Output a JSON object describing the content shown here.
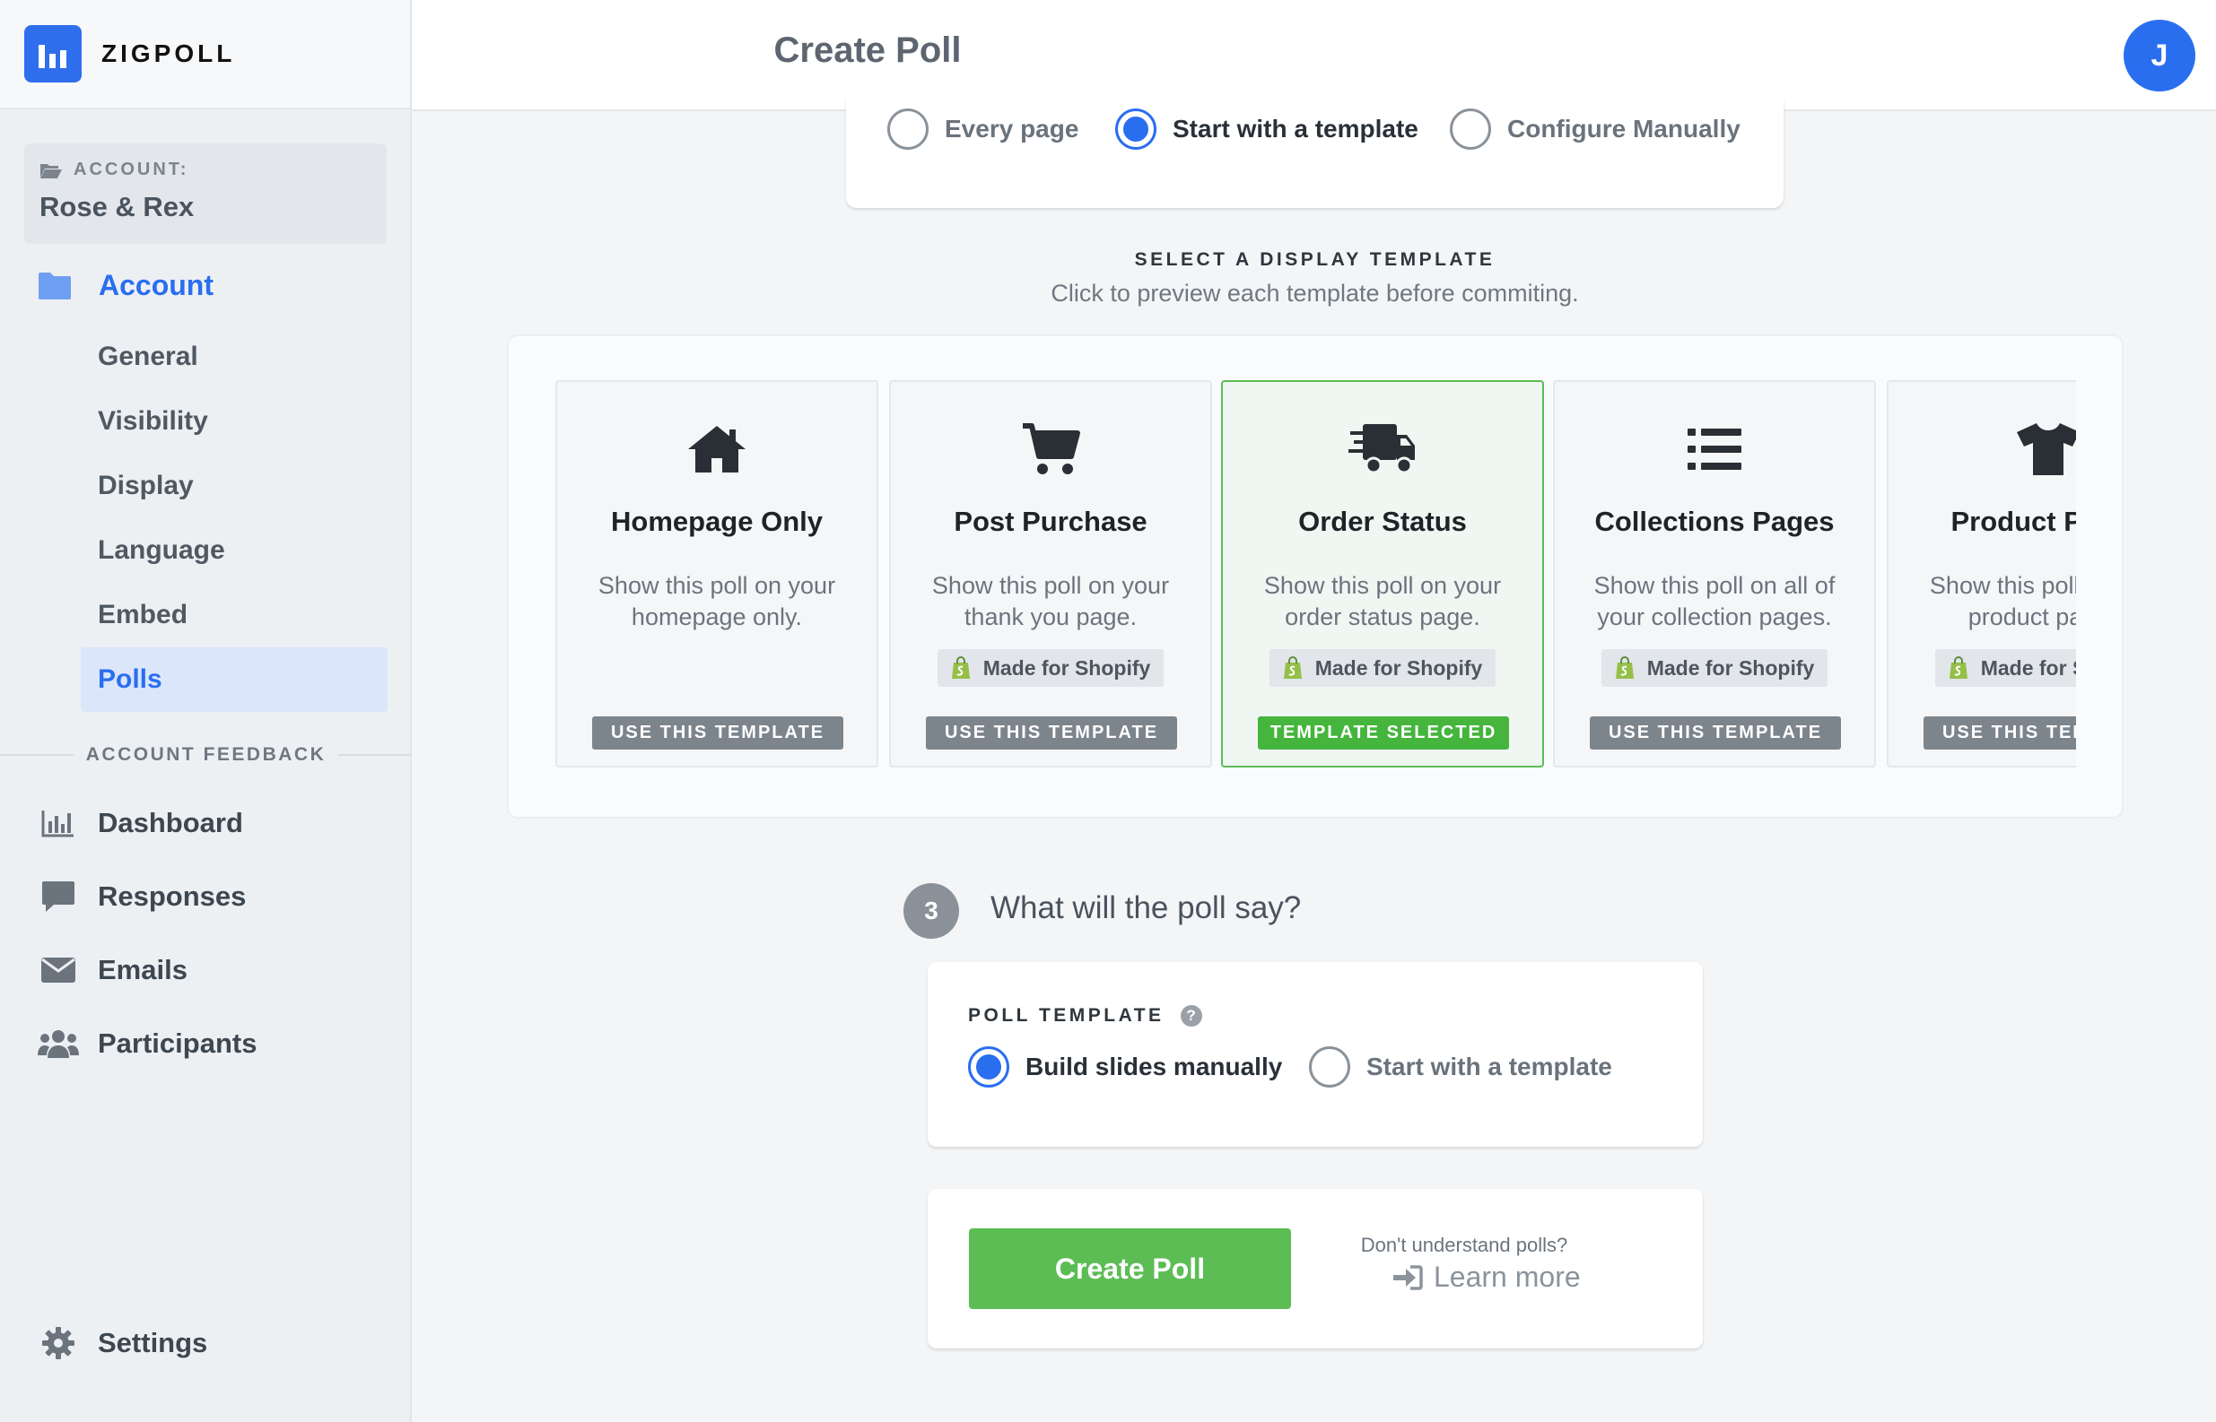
{
  "brand": {
    "name": "ZIGPOLL"
  },
  "sidebar": {
    "account_caption": "ACCOUNT:",
    "account_name": "Rose & Rex",
    "section_label": "Account",
    "subnav": [
      {
        "label": "General"
      },
      {
        "label": "Visibility"
      },
      {
        "label": "Display"
      },
      {
        "label": "Language"
      },
      {
        "label": "Embed"
      },
      {
        "label": "Polls",
        "active": true
      }
    ],
    "feedback_divider": "ACCOUNT FEEDBACK",
    "feedback_items": [
      {
        "label": "Dashboard",
        "icon": "bar-chart-icon"
      },
      {
        "label": "Responses",
        "icon": "speech-bubble-icon"
      },
      {
        "label": "Emails",
        "icon": "envelope-icon"
      },
      {
        "label": "Participants",
        "icon": "users-icon"
      }
    ],
    "settings_label": "Settings"
  },
  "header": {
    "title": "Create Poll",
    "avatar_initial": "J"
  },
  "page_selector": {
    "options": [
      {
        "label": "Every page",
        "selected": false
      },
      {
        "label": "Start with a template",
        "selected": true
      },
      {
        "label": "Configure Manually",
        "selected": false
      }
    ]
  },
  "display_template": {
    "caption": "SELECT A DISPLAY TEMPLATE",
    "subcaption": "Click to preview each template before commiting.",
    "templates": [
      {
        "icon": "house-icon",
        "title": "Homepage Only",
        "description": "Show this poll on your homepage only.",
        "badge": "",
        "button": "USE THIS TEMPLATE",
        "selected": false
      },
      {
        "icon": "cart-icon",
        "title": "Post Purchase",
        "description": "Show this poll on your thank you page.",
        "badge": "Made for Shopify",
        "button": "USE THIS TEMPLATE",
        "selected": false
      },
      {
        "icon": "delivery-truck-icon",
        "title": "Order Status",
        "description": "Show this poll on your order status page.",
        "badge": "Made for Shopify",
        "button": "TEMPLATE SELECTED",
        "selected": true
      },
      {
        "icon": "list-icon",
        "title": "Collections Pages",
        "description": "Show this poll on all of your collection pages.",
        "badge": "Made for Shopify",
        "button": "USE THIS TEMPLATE",
        "selected": false
      },
      {
        "icon": "tshirt-icon",
        "title": "Product Pages",
        "description": "Show this poll on your product pages.",
        "badge": "Made for Shopify",
        "button": "USE THIS TEMPLATE",
        "selected": false
      }
    ]
  },
  "step3": {
    "number": "3",
    "title": "What will the poll say?"
  },
  "poll_template": {
    "caption": "POLL TEMPLATE",
    "help": "?",
    "options": [
      {
        "label": "Build slides manually",
        "selected": true
      },
      {
        "label": "Start with a template",
        "selected": false
      }
    ]
  },
  "actions": {
    "create_button": "Create Poll",
    "help_question": "Don't understand polls?",
    "learn_more": "Learn more"
  },
  "colors": {
    "accent_blue": "#2a6ef0",
    "success_green": "#5cbd55",
    "shopify_green": "#95bf47"
  }
}
